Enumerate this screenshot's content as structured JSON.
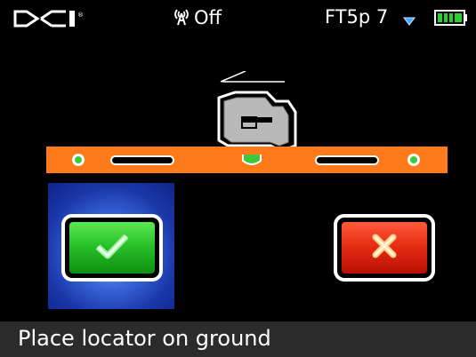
{
  "status_bar": {
    "logo_icon": "dci-logo-icon",
    "radio": {
      "icon": "radio-antenna-icon",
      "label": "Off"
    },
    "channel": "FT5p 7",
    "signal_icon": "down-triangle-icon",
    "battery_icon": "battery-full-icon"
  },
  "main": {
    "carriage_icon": "locator-carriage-icon",
    "level_bar_icon": "level-bar-icon",
    "accept_button": {
      "icon": "checkmark-icon",
      "selected": true
    },
    "reject_button": {
      "icon": "x-icon"
    }
  },
  "footer": {
    "message": "Place locator on ground"
  },
  "colors": {
    "level_bar": "#ff7a1a",
    "accept": "#29c22a",
    "reject": "#e32a12",
    "selection": "#1a36a8",
    "footer_bg": "#2b2b2b"
  }
}
